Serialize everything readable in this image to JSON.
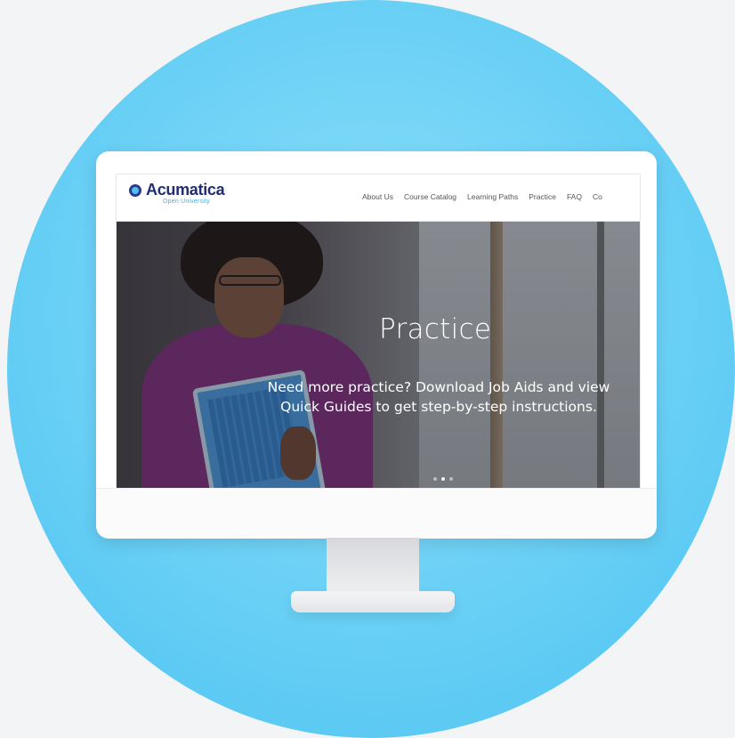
{
  "site": {
    "logo_name": "Acumatica",
    "logo_sub": "Open University"
  },
  "nav": {
    "items": [
      {
        "label": "About Us"
      },
      {
        "label": "Course Catalog"
      },
      {
        "label": "Learning Paths"
      },
      {
        "label": "Practice"
      },
      {
        "label": "FAQ"
      },
      {
        "label": "Co"
      }
    ]
  },
  "hero": {
    "title": "Practice",
    "line1": "Need more practice? Download Job Aids and view",
    "line2": "Quick Guides to get step-by-step instructions.",
    "slides_total": 3,
    "slide_active": 1
  },
  "colors": {
    "brand_navy": "#1f2e75",
    "brand_cyan": "#3bb3e6",
    "circle_blue": "#4cc3f1",
    "shirt_purple": "#6b2a6a"
  }
}
